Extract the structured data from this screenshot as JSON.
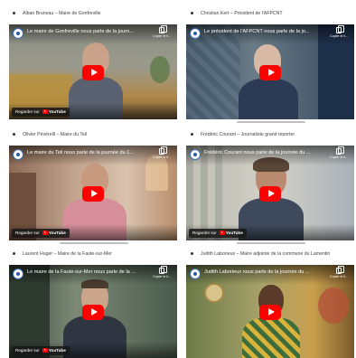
{
  "common": {
    "copy_label": "Copier le li...",
    "watch_label": "Regarder sur",
    "youtube_label": "YouTube",
    "play_color": "#ff0000"
  },
  "videos": [
    {
      "caption": "Alban Bruneau – Maire de Gonfreville",
      "title": "Le maire de Gonfreville nous parle de la journ..."
    },
    {
      "caption": "Christian Kert – Président de l'AFPCNT",
      "title": "Le président de l'AFPCNT nous parle de la jo..."
    },
    {
      "caption": "Olivier Pévérelli – Maire du Teil",
      "title": "Le maire du Teil nous parle de la journée du 1..."
    },
    {
      "caption": "Frédéric Courant – Journaliste grand reporter",
      "title": "Frédéric Courant nous parle de la journée du ..."
    },
    {
      "caption": "Laurent Huger – Maire de la Faute-sur-Mer",
      "title": "Le maire de la Faute-sur-Mer nous parle de la ..."
    },
    {
      "caption": "Judith Laborieux – Maire adjointe de la commune du Lamentin",
      "title": "Judith Laborieux nous parle de la journée du ..."
    }
  ]
}
